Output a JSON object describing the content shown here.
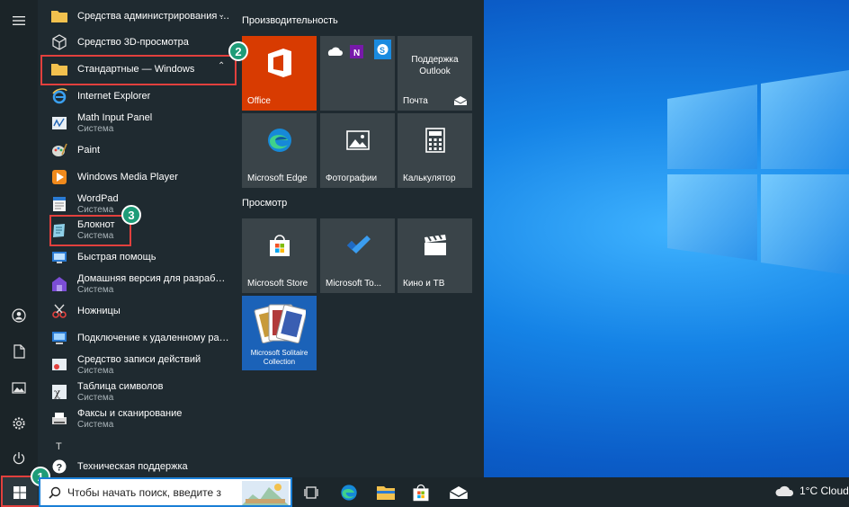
{
  "start_menu": {
    "apps": [
      {
        "name": "Средства администрирования W...",
        "sub": "",
        "icon": "folder-icon"
      },
      {
        "name": "Средство 3D-просмотра",
        "sub": "",
        "icon": "cube-icon"
      },
      {
        "name": "Стандартные — Windows",
        "sub": "",
        "icon": "folder-icon"
      },
      {
        "name": "Internet Explorer",
        "sub": "",
        "icon": "internet-explorer-icon"
      },
      {
        "name": "Math Input Panel",
        "sub": "Система",
        "icon": "math-input-icon"
      },
      {
        "name": "Paint",
        "sub": "",
        "icon": "paint-icon"
      },
      {
        "name": "Windows Media Player",
        "sub": "",
        "icon": "media-player-icon"
      },
      {
        "name": "WordPad",
        "sub": "Система",
        "icon": "wordpad-icon"
      },
      {
        "name": "Блокнот",
        "sub": "Система",
        "icon": "notepad-icon"
      },
      {
        "name": "Быстрая помощь",
        "sub": "",
        "icon": "quick-assist-icon"
      },
      {
        "name": "Домашняя версия для разработч...",
        "sub": "Система",
        "icon": "dev-home-icon"
      },
      {
        "name": "Ножницы",
        "sub": "",
        "icon": "snipping-icon"
      },
      {
        "name": "Подключение к удаленному рабо...",
        "sub": "",
        "icon": "remote-desktop-icon"
      },
      {
        "name": "Средство записи действий",
        "sub": "Система",
        "icon": "steps-recorder-icon"
      },
      {
        "name": "Таблица символов",
        "sub": "Система",
        "icon": "charmap-icon"
      },
      {
        "name": "Факсы и сканирование",
        "sub": "Система",
        "icon": "fax-scan-icon"
      },
      {
        "name": "Техническая поддержка",
        "sub": "",
        "icon": "help-icon"
      }
    ],
    "letter_t": "Т",
    "groups": {
      "productivity": "Производительность",
      "explore": "Просмотр"
    },
    "tiles": {
      "office": "Office",
      "mail_top": "Поддержка Outlook",
      "mail": "Почта",
      "edge": "Microsoft Edge",
      "photos": "Фотографии",
      "calc": "Калькулятор",
      "store": "Microsoft Store",
      "todo": "Microsoft To...",
      "movies": "Кино и ТВ",
      "solitaire": "Microsoft Solitaire Collection"
    }
  },
  "annotations": {
    "b1": "1",
    "b2": "2",
    "b3": "3"
  },
  "taskbar": {
    "search_placeholder": "Чтобы начать поиск, введите з",
    "weather": "1°C  Cloud"
  },
  "colors": {
    "accent": "#0078d4",
    "office": "#d83b01",
    "highlight": "#e2403d",
    "badge": "#1e9c78"
  }
}
